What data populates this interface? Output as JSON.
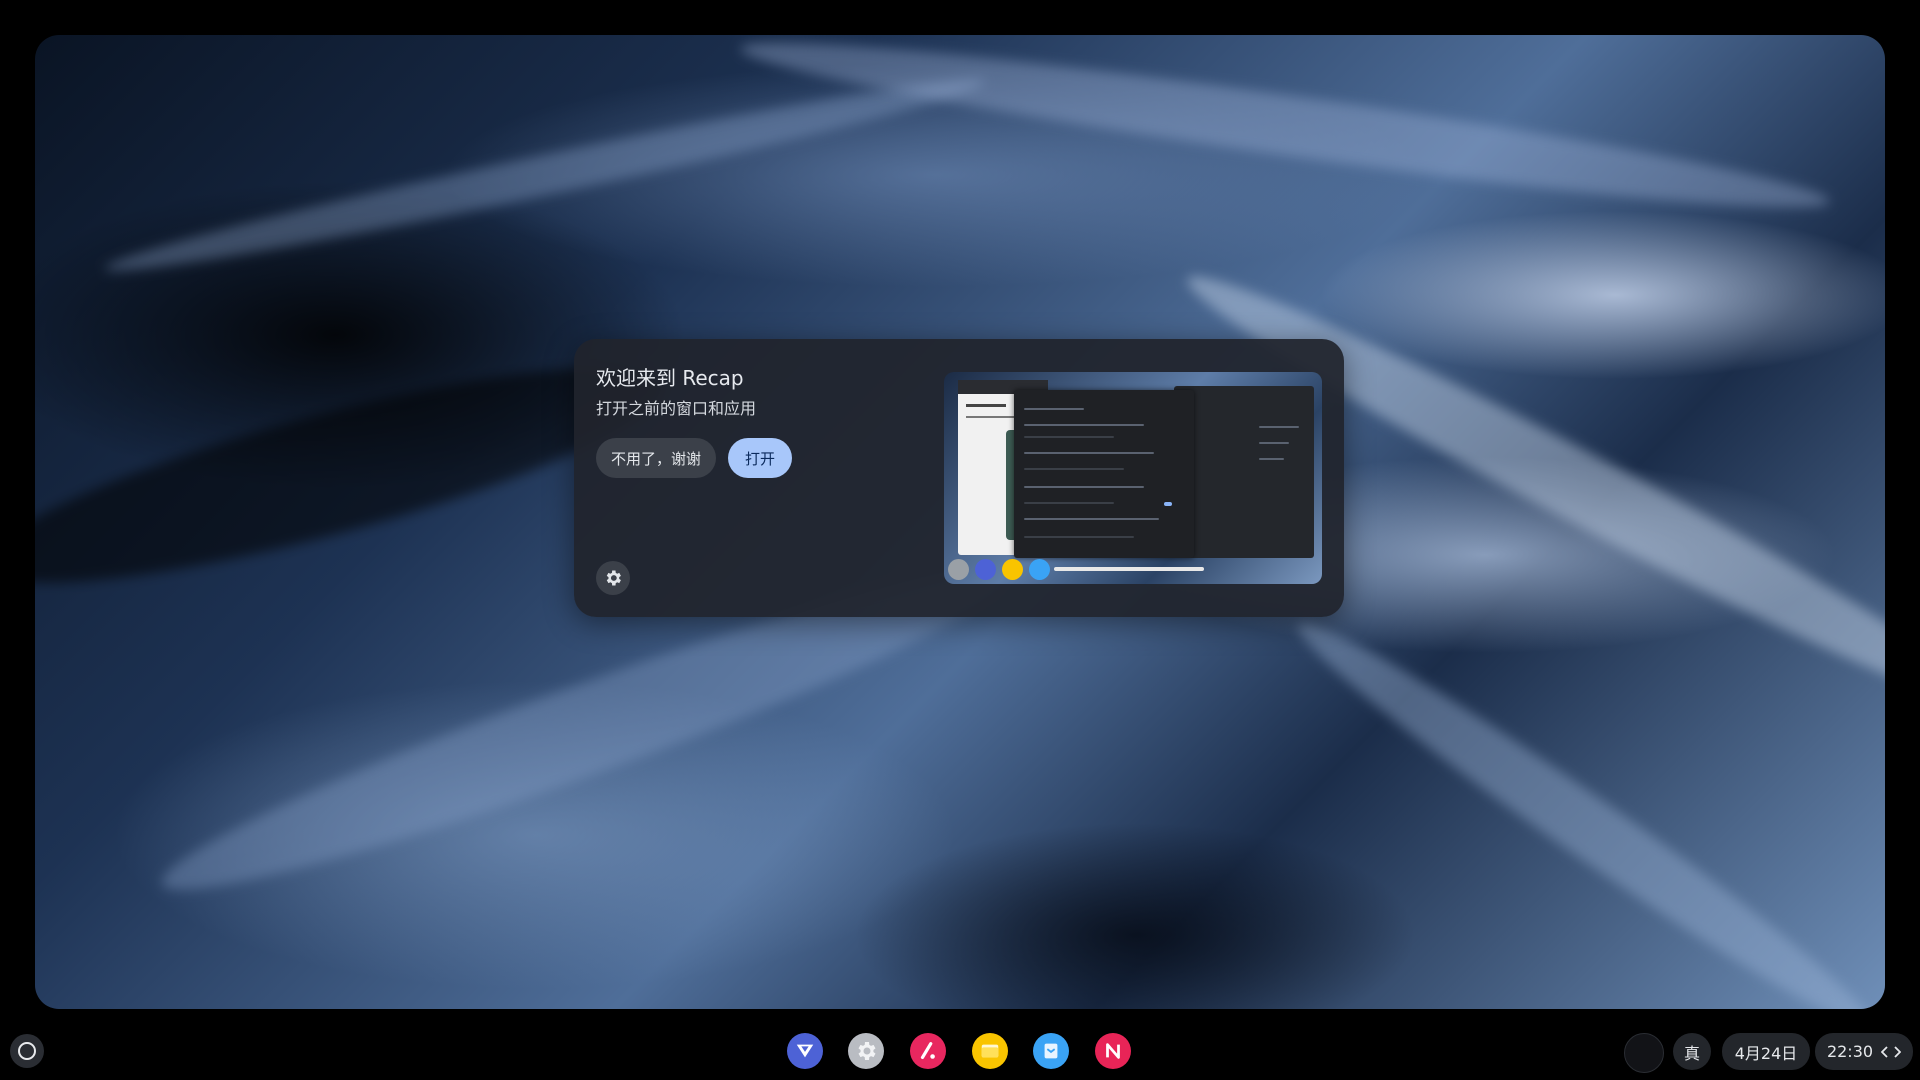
{
  "recap": {
    "title": "欢迎来到 Recap",
    "subtitle": "打开之前的窗口和应用",
    "no_thanks_label": "不用了，谢谢",
    "open_label": "打开",
    "settings_icon": "gear-icon",
    "preview_icons": [
      "settings-app-icon",
      "play-store-icon",
      "files-icon",
      "app-icon"
    ]
  },
  "shelf": {
    "launcher_icon": "launcher-circle-icon",
    "apps": [
      {
        "name": "play-store",
        "color": "#4d62d6"
      },
      {
        "name": "settings",
        "color": "#b9bcc2"
      },
      {
        "name": "app-red",
        "color": "#e8275f"
      },
      {
        "name": "files",
        "color": "#f9c400"
      },
      {
        "name": "app-blue",
        "color": "#3aa3f5"
      },
      {
        "name": "app-n",
        "color": "#e82457"
      }
    ],
    "ime_label": "真",
    "date_label": "4月24日",
    "time_label": "22:30"
  }
}
